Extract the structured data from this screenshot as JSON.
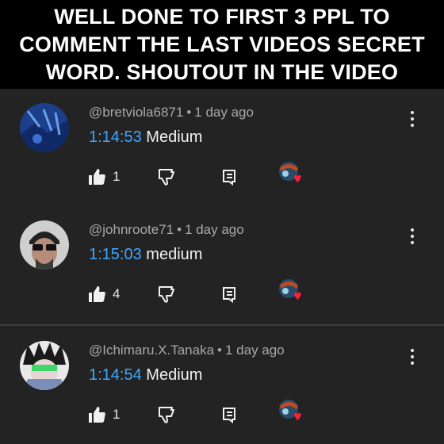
{
  "banner": {
    "text": "WELL DONE TO FIRST 3 PPL TO\nCOMMENT THE LAST VIDEOS SECRET\nWORD.  SHOUTOUT IN THE VIDEO"
  },
  "colors": {
    "background": "#232323",
    "timestamp_link": "#3ea6ff",
    "heart": "#ff1f3d"
  },
  "icons": {
    "like": "thumbs-up-icon",
    "dislike": "thumbs-down-icon",
    "reply": "reply-icon",
    "more": "more-vertical-icon",
    "creator_heart": "creator-heart-icon"
  },
  "comments": [
    {
      "username": "@bretviola6871",
      "age": "1 day ago",
      "timestamp": "1:14:53",
      "text": "Medium",
      "likes": "1"
    },
    {
      "username": "@johnroote71",
      "age": "1 day ago",
      "timestamp": "1:15:03",
      "text": "medium",
      "likes": "4"
    },
    {
      "username": "@Ichimaru.X.Tanaka",
      "age": "1 day ago",
      "timestamp": "1:14:54",
      "text": "Medium",
      "likes": "1"
    }
  ],
  "separator": "•"
}
